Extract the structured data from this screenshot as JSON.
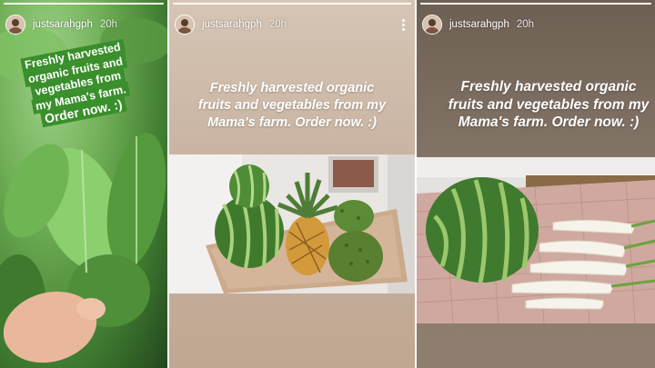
{
  "stories": [
    {
      "username": "justsarahgph",
      "time": "20h",
      "caption_lines": [
        "Freshly harvested",
        "organic fruits and",
        "vegetables from",
        "my Mama's farm.",
        "Order now. :)"
      ],
      "caption_color": "#3a8f2c",
      "photo": "spinach-leaves-with-hand",
      "progress": 1.0
    },
    {
      "username": "justsarahgph",
      "time": "20h",
      "caption_lines": [
        "Freshly harvested organic",
        "fruits and vegetables from my",
        "Mama's farm. Order now. :)"
      ],
      "menu_icon": "more-vertical-icon",
      "photo": "watermelons-pineapple-soursop",
      "progress": 1.0
    },
    {
      "username": "justsarahgph",
      "time": "20h",
      "caption_lines": [
        "Freshly harvested organic",
        "fruits and vegetables from my",
        "Mama's farm. Order now. :)"
      ],
      "photo": "watermelon-and-white-radish",
      "progress": 1.0
    }
  ]
}
